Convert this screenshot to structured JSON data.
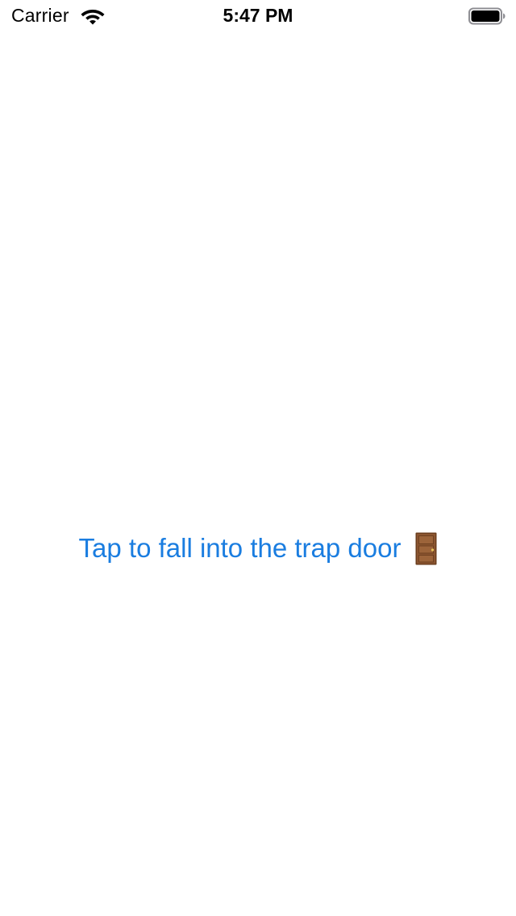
{
  "status_bar": {
    "carrier": "Carrier",
    "time": "5:47 PM",
    "wifi_icon": "wifi-icon",
    "battery_icon": "battery-full-icon"
  },
  "main": {
    "button_label": "Tap to fall into the trap door",
    "button_icon": "door-icon",
    "button_color": "#1a7de0"
  }
}
